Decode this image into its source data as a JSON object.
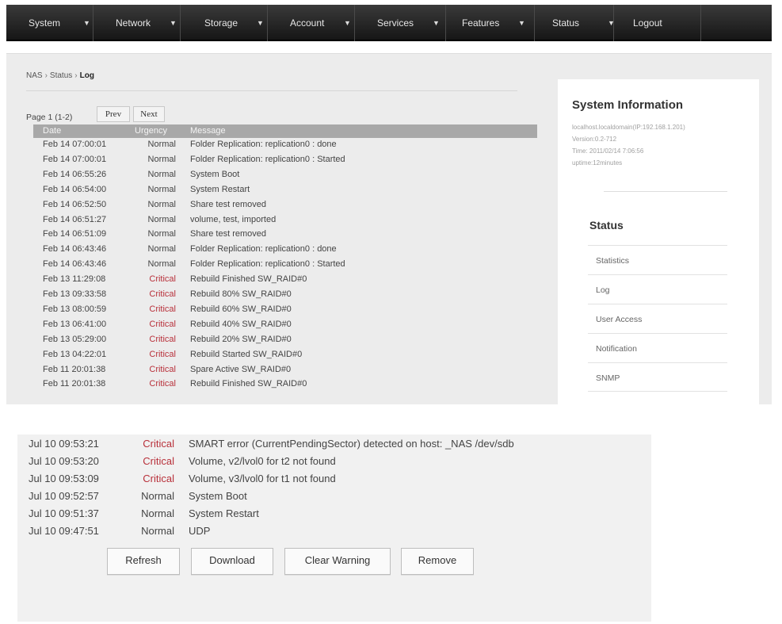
{
  "nav": {
    "items": [
      {
        "label": "System",
        "icon": "chevron-down-icon",
        "chev": "▼"
      },
      {
        "label": "Network",
        "icon": "chevron-down-icon",
        "chev": "▼"
      },
      {
        "label": "Storage",
        "icon": "chevron-down-icon",
        "chev": "▼"
      },
      {
        "label": "Account",
        "icon": "chevron-down-icon",
        "chev": "▼"
      },
      {
        "label": "Services",
        "icon": "chevron-down-icon",
        "chev": "▼"
      },
      {
        "label": "Features",
        "icon": "chevron-down-icon",
        "chev": "▼"
      },
      {
        "label": "Status",
        "icon": "chevron-down-icon",
        "chev": "▼"
      }
    ],
    "logout": "Logout"
  },
  "breadcrumb": {
    "items": [
      "NAS",
      "Status"
    ],
    "separator": "›",
    "current": "Log"
  },
  "pager": {
    "text": "Page 1 (1-2)",
    "prev": "Prev",
    "next": "Next"
  },
  "log": {
    "headers": {
      "date": "Date",
      "urgency": "Urgency",
      "message": "Message"
    },
    "rows": [
      {
        "date": "Feb 14 07:00:01",
        "urgency": "Normal",
        "message": "Folder Replication: replication0 : done"
      },
      {
        "date": "Feb 14 07:00:01",
        "urgency": "Normal",
        "message": "Folder Replication: replication0 : Started"
      },
      {
        "date": "Feb 14 06:55:26",
        "urgency": "Normal",
        "message": "System Boot"
      },
      {
        "date": "Feb 14 06:54:00",
        "urgency": "Normal",
        "message": "System Restart"
      },
      {
        "date": "Feb 14 06:52:50",
        "urgency": "Normal",
        "message": "Share test removed"
      },
      {
        "date": "Feb 14 06:51:27",
        "urgency": "Normal",
        "message": "volume, test, imported"
      },
      {
        "date": "Feb 14 06:51:09",
        "urgency": "Normal",
        "message": "Share test removed"
      },
      {
        "date": "Feb 14 06:43:46",
        "urgency": "Normal",
        "message": "Folder Replication: replication0 : done"
      },
      {
        "date": "Feb 14 06:43:46",
        "urgency": "Normal",
        "message": "Folder Replication: replication0 : Started"
      },
      {
        "date": "Feb 13 11:29:08",
        "urgency": "Critical",
        "message": "Rebuild Finished SW_RAID#0"
      },
      {
        "date": "Feb 13 09:33:58",
        "urgency": "Critical",
        "message": "Rebuild 80% SW_RAID#0"
      },
      {
        "date": "Feb 13 08:00:59",
        "urgency": "Critical",
        "message": "Rebuild 60% SW_RAID#0"
      },
      {
        "date": "Feb 13 06:41:00",
        "urgency": "Critical",
        "message": "Rebuild 40% SW_RAID#0"
      },
      {
        "date": "Feb 13 05:29:00",
        "urgency": "Critical",
        "message": "Rebuild 20% SW_RAID#0"
      },
      {
        "date": "Feb 13 04:22:01",
        "urgency": "Critical",
        "message": "Rebuild Started SW_RAID#0"
      },
      {
        "date": "Feb 11 20:01:38",
        "urgency": "Critical",
        "message": "Spare Active SW_RAID#0"
      },
      {
        "date": "Feb 11 20:01:38",
        "urgency": "Critical",
        "message": "Rebuild Finished SW_RAID#0"
      }
    ]
  },
  "sidebar": {
    "title": "System Information",
    "info": [
      "localhost.localdomain(IP:192.168.1.201)",
      "Version:0.2-712",
      "Time: 2011/02/14 7:06:56",
      "uptime:12minutes"
    ],
    "status_title": "Status",
    "links": [
      "Statistics",
      "Log",
      "User Access",
      "Notification",
      "SNMP"
    ]
  },
  "lower_log": {
    "rows": [
      {
        "date": "Jul 10 09:53:21",
        "urgency": "Critical",
        "message": "SMART error (CurrentPendingSector) detected on host: _NAS /dev/sdb"
      },
      {
        "date": "Jul 10 09:53:20",
        "urgency": "Critical",
        "message": "Volume, v2/lvol0 for t2 not found"
      },
      {
        "date": "Jul 10 09:53:09",
        "urgency": "Critical",
        "message": "Volume, v3/lvol0 for t1 not found"
      },
      {
        "date": "Jul 10 09:52:57",
        "urgency": "Normal",
        "message": "System Boot"
      },
      {
        "date": "Jul 10 09:51:37",
        "urgency": "Normal",
        "message": "System Restart"
      },
      {
        "date": "Jul 10 09:47:51",
        "urgency": "Normal",
        "message": "UDP"
      }
    ]
  },
  "actions": {
    "refresh": "Refresh",
    "download": "Download",
    "clear_warning": "Clear Warning",
    "remove": "Remove"
  },
  "colors": {
    "critical": "#b8303a",
    "navbar": "#1e1e1e",
    "header": "#a8a8a8"
  }
}
